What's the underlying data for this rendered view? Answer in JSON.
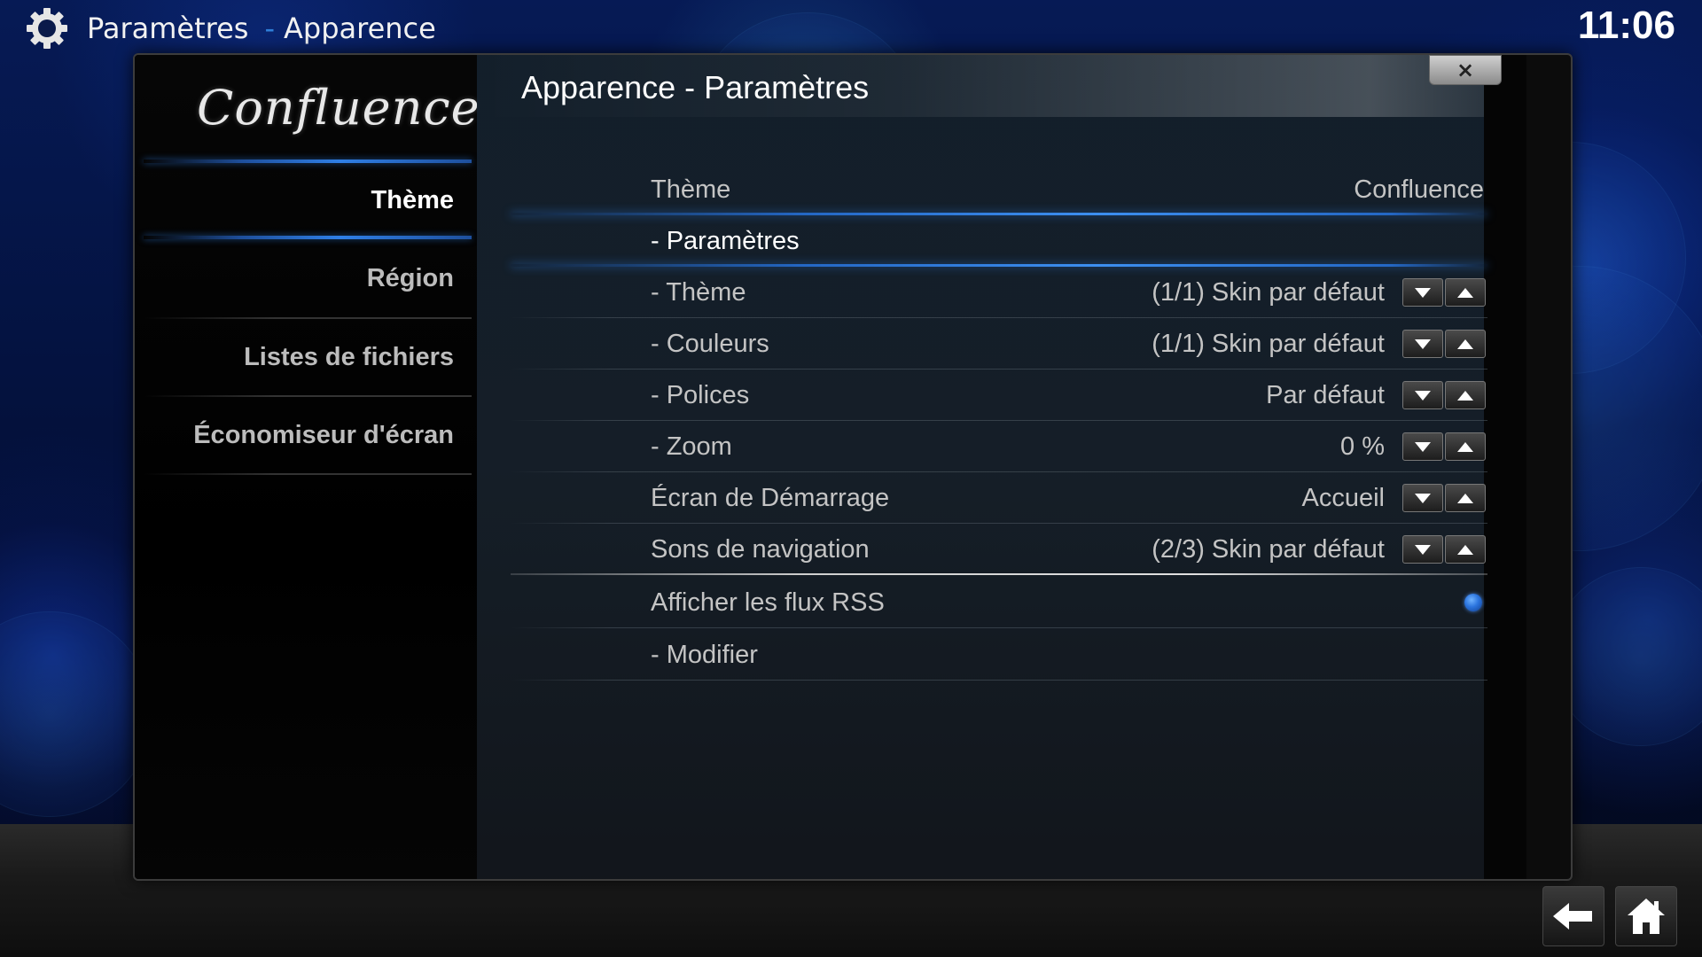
{
  "header": {
    "section": "Paramètres",
    "separator": "-",
    "page": "Apparence",
    "clock": "11:06",
    "icon": "gear-icon"
  },
  "sidebar": {
    "logo": "Confluence",
    "items": [
      {
        "label": "Thème",
        "active": true
      },
      {
        "label": "Région",
        "active": false
      },
      {
        "label": "Listes de fichiers",
        "active": false
      },
      {
        "label": "Économiseur d'écran",
        "active": false
      }
    ]
  },
  "dialog": {
    "title": "Apparence - Paramètres",
    "close_label": "×"
  },
  "settings": [
    {
      "label": "Thème",
      "value": "Confluence",
      "control": "none"
    },
    {
      "label": "- Paramètres",
      "value": "",
      "control": "none",
      "focused": true
    },
    {
      "label": "- Thème",
      "value": "(1/1) Skin par défaut",
      "control": "spin"
    },
    {
      "label": "- Couleurs",
      "value": "(1/1) Skin par défaut",
      "control": "spin"
    },
    {
      "label": "- Polices",
      "value": "Par défaut",
      "control": "spin"
    },
    {
      "label": "- Zoom",
      "value": "0 %",
      "control": "spin"
    },
    {
      "label": "Écran de Démarrage",
      "value": "Accueil",
      "control": "spin"
    },
    {
      "label": "Sons de navigation",
      "value": "(2/3) Skin par défaut",
      "control": "spin"
    },
    {
      "label": "Afficher les flux RSS",
      "value": "",
      "control": "toggle",
      "checked": true
    },
    {
      "label": "- Modifier",
      "value": "",
      "control": "none"
    }
  ],
  "footer": {
    "back_icon": "back-arrow-icon",
    "home_icon": "home-icon"
  },
  "colors": {
    "accent": "#2f7fd8",
    "focus_line": "#3d8ff0",
    "text_primary": "#ffffff",
    "text_secondary": "#c4c4c4"
  }
}
